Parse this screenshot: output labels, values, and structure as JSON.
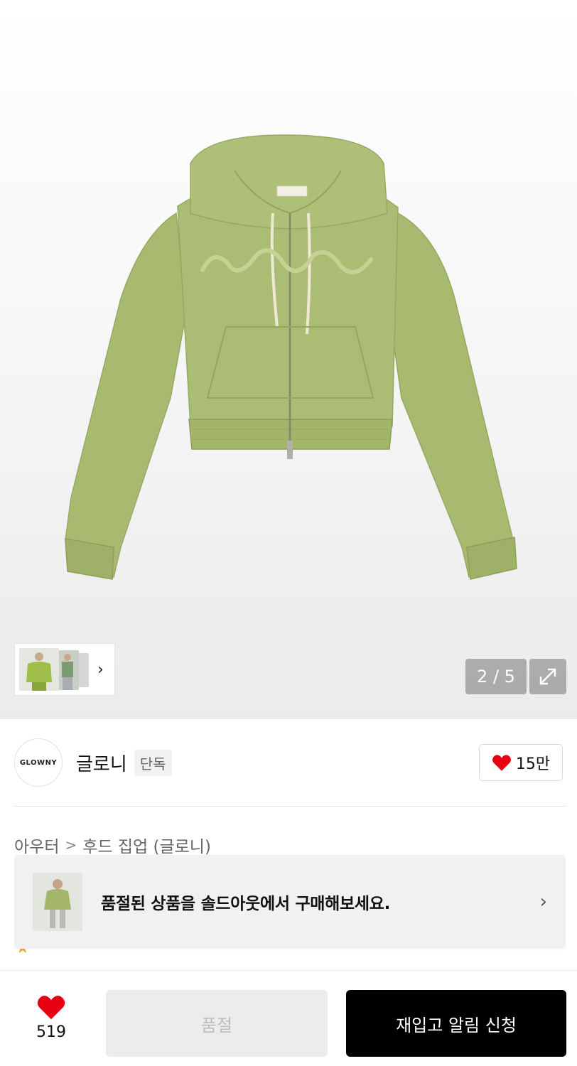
{
  "gallery": {
    "counter": "2 / 5"
  },
  "brand": {
    "logo_text": "GLOWNY",
    "name": "글로니",
    "badge": "단독",
    "like_count": "15만"
  },
  "breadcrumb": {
    "category": "아우터",
    "separator": ">",
    "subcategory": "후드 집업 (글로니)"
  },
  "soldout_banner": {
    "text": "품절된 상품을 솔드아웃에서 구매해보세요."
  },
  "bottom_bar": {
    "favorite_count": "519",
    "soldout_label": "품절",
    "restock_label": "재입고 알림 신청"
  },
  "colors": {
    "hoodie_green": "#a9bb72",
    "heart_red": "#e60012",
    "primary_black": "#000000"
  }
}
